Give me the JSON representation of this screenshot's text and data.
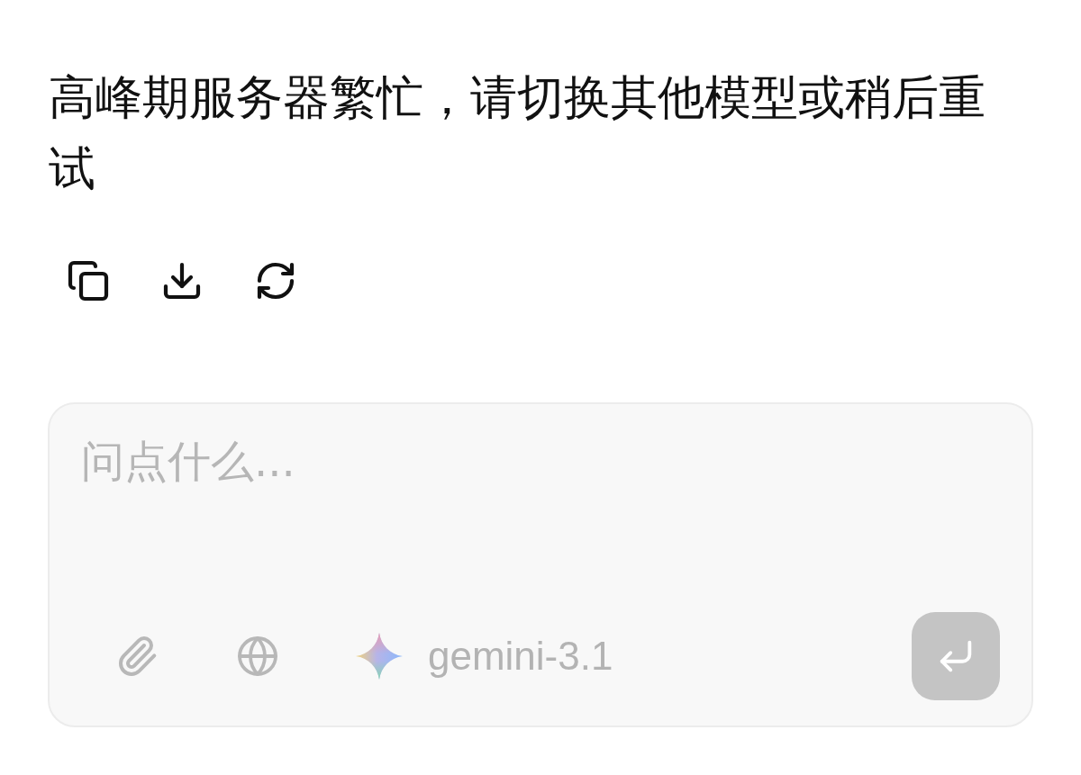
{
  "message": {
    "text": "高峰期服务器繁忙，请切换其他模型或稍后重试"
  },
  "composer": {
    "placeholder": "问点什么...",
    "model": {
      "name": "gemini-3.1"
    },
    "send": {
      "disabled": true
    }
  }
}
